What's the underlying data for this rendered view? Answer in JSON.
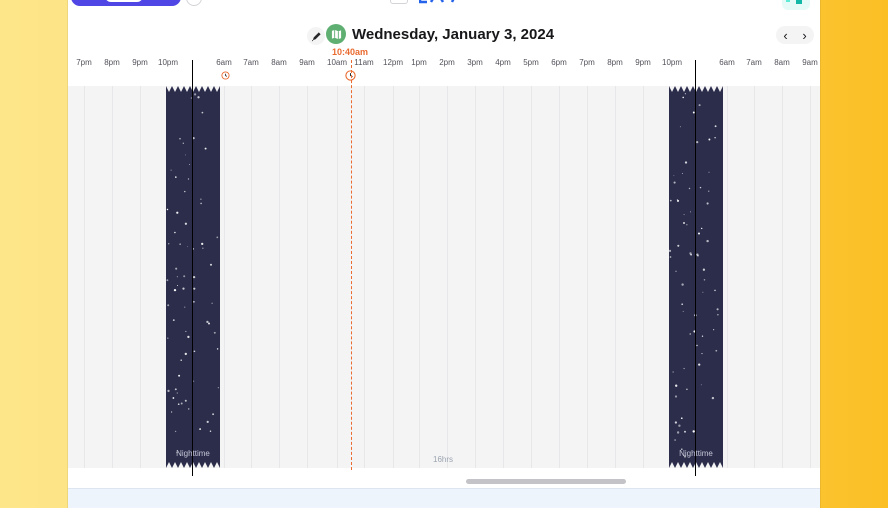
{
  "header": {
    "date_title": "Wednesday, January 3, 2024",
    "prev_label": "‹",
    "next_label": "›"
  },
  "now_indicator": {
    "time_label": "10:40am"
  },
  "timeline": {
    "hours": [
      "7pm",
      "8pm",
      "9pm",
      "10pm",
      "6am",
      "7am",
      "8am",
      "9am",
      "10am",
      "11am",
      "12pm",
      "1pm",
      "2pm",
      "3pm",
      "4pm",
      "5pm",
      "6pm",
      "7pm",
      "8pm",
      "9pm",
      "10pm",
      "6am",
      "7am",
      "8am",
      "9am"
    ]
  },
  "night_blocks": [
    {
      "label": "Nighttime"
    },
    {
      "label": "Nighttime"
    }
  ],
  "duration_label": "16hrs",
  "icons": {
    "pen": "pen-icon",
    "map": "map-icon",
    "alarm": "alarm-clock-icon"
  },
  "colors": {
    "accent_indigo": "#4f46e5",
    "now_orange": "#ea6a2f",
    "night_navy": "#2b2d4b",
    "map_green": "#5faf73",
    "background_yellow": "#fcd96b"
  }
}
